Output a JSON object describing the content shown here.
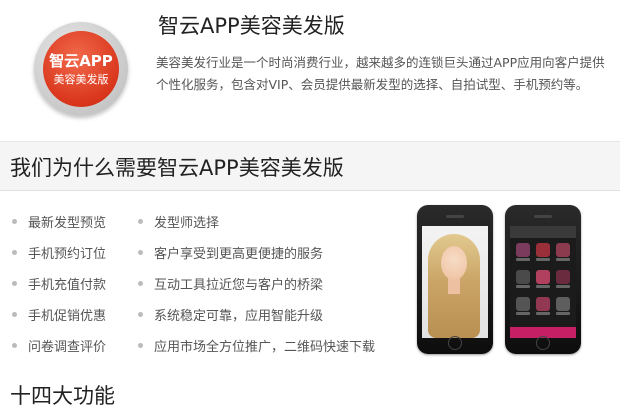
{
  "logo": {
    "line1": "智云APP",
    "line2": "美容美发版"
  },
  "header": {
    "title": "智云APP美容美发版",
    "description": "美容美发行业是一个时尚消费行业，越来越多的连锁巨头通过APP应用向客户提供个性化服务，包含对VIP、会员提供最新发型的选择、自拍试型、手机预约等。"
  },
  "why": {
    "heading": "我们为什么需要智云APP美容美发版",
    "features_left": [
      "最新发型预览",
      "手机预约订位",
      "手机充值付款",
      "手机促销优惠",
      "问卷调查评价"
    ],
    "features_right": [
      "发型师选择",
      "客户享受到更高更便捷的服务",
      "互动工具拉近您与客户的桥梁",
      "系统稳定可靠，应用智能升级",
      "应用市场全方位推广，二维码快速下载"
    ]
  },
  "functions": {
    "heading": "十四大功能"
  },
  "colors": {
    "logo_red": "#d9361c",
    "accent_pink": "#c71f66",
    "band_bg": "#f5f5f5"
  },
  "icons": [
    "bullet-dot",
    "phone-mockup"
  ]
}
